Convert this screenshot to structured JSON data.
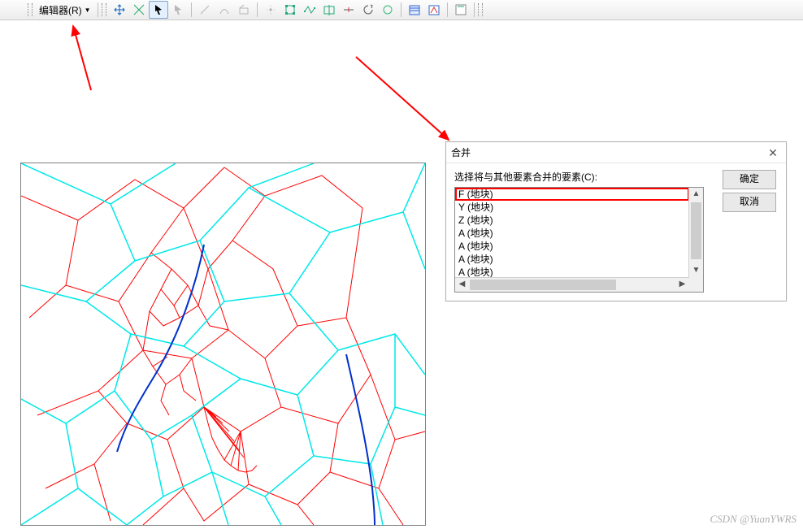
{
  "toolbar": {
    "editor_label": "编辑器(R)"
  },
  "dialog": {
    "title": "合并",
    "prompt": "选择将与其他要素合并的要素(C):",
    "ok_label": "确定",
    "cancel_label": "取消",
    "items": [
      "F (地块)",
      "Y (地块)",
      "Z (地块)",
      "A (地块)",
      "A (地块)",
      "A (地块)",
      "A (地块)"
    ]
  },
  "watermark": "CSDN @YuanYWRS"
}
